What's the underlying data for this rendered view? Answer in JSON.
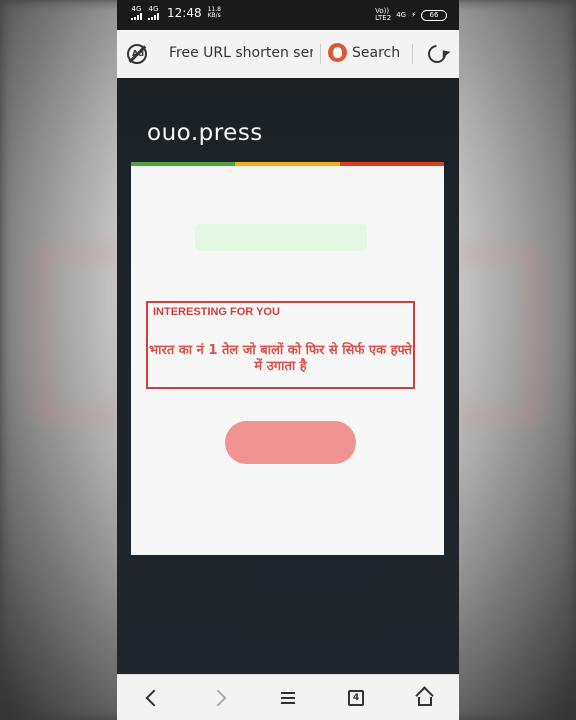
{
  "status_bar": {
    "sim1": "4G",
    "sim2": "4G",
    "time": "12:48",
    "net_speed_value": "11.8",
    "net_speed_unit": "KB/s",
    "volte1": "Vo))",
    "volte2": "LTE2",
    "sim3": "4G",
    "battery": "66"
  },
  "toolbar": {
    "adblock_icon": "adblock-icon",
    "adblock_text": "Ad",
    "tab_title": "Free URL shorten serv",
    "search_label": "Search",
    "search_icon": "duckduckgo-icon",
    "reload_icon": "reload-icon"
  },
  "page": {
    "logo": "ouo.press",
    "stripe_colors": [
      "#4fa53a",
      "#f0b21b",
      "#e23c1f"
    ],
    "ad": {
      "label": "INTERESTING FOR YOU",
      "text": "भारत का नं 1 तेल जो बालों को फिर से सिर्फ एक हफ्ते में उगाता है"
    },
    "accent_color": "#ef9491"
  },
  "bottom_nav": {
    "tab_count": "4",
    "icons": [
      "back-icon",
      "forward-icon",
      "menu-icon",
      "tabs-icon",
      "home-icon"
    ]
  }
}
